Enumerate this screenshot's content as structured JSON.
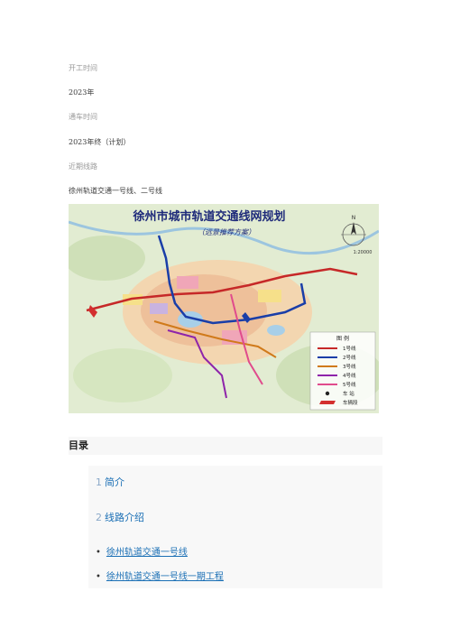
{
  "meta": [
    {
      "label": "开工时间",
      "value": "2023年"
    },
    {
      "label": "通车时间",
      "value": "2023年终（计划）"
    },
    {
      "label": "近期线路",
      "value": "徐州轨道交通一号线、二号线"
    }
  ],
  "map": {
    "title": "徐州市城市轨道交通线网规划",
    "subtitle": "（远景推荐方案）",
    "scale_label": "1:20000",
    "north_label": "N",
    "legend": {
      "heading": "图  例",
      "items": [
        {
          "label": "1号线",
          "color": "#c62828"
        },
        {
          "label": "2号线",
          "color": "#1a3ea8"
        },
        {
          "label": "3号线",
          "color": "#d07a1a"
        },
        {
          "label": "4号线",
          "color": "#8e24aa"
        },
        {
          "label": "5号线",
          "color": "#e04b8c"
        },
        {
          "label": "车  站",
          "color": "#222222"
        },
        {
          "label": "车辆段",
          "color": "#d32f2f"
        }
      ]
    }
  },
  "toc": {
    "title": "目录",
    "sections": [
      {
        "num": "1",
        "label": "简介"
      },
      {
        "num": "2",
        "label": "线路介绍"
      }
    ],
    "links": [
      {
        "bullet": "•",
        "label": "徐州轨道交通一号线"
      },
      {
        "bullet": "•",
        "label": "徐州轨道交通一号线一期工程"
      }
    ]
  }
}
